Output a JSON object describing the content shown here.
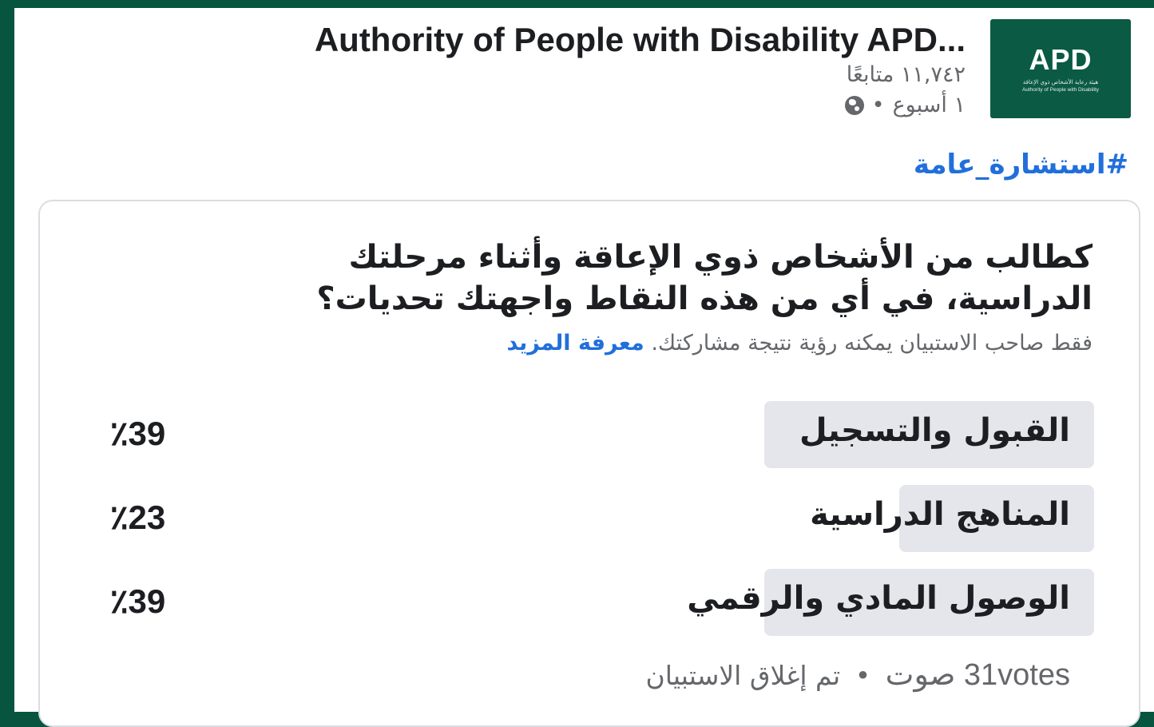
{
  "post": {
    "page_name": "Authority of People with Disability APD...",
    "followers": "١١,٧٤٢ متابعًا",
    "time": "١ أسبوع",
    "dot": "•",
    "hashtag": "#استشارة_عامة",
    "logo": {
      "mark": "APD",
      "subtitle_ar": "هيئة رعاية الأشخاص ذوي الإعاقة",
      "subtitle_en": "Authority of People with Disability",
      "color": "#0b5a44"
    },
    "globe_icon": "globe-icon"
  },
  "poll": {
    "question_line1": "كطالب من الأشخاص ذوي الإعاقة وأثناء مرحلتك",
    "question_line2": "الدراسية، في أي من هذه النقاط واجهتك تحديات؟",
    "notice": "فقط صاحب الاستبيان يمكنه رؤية نتيجة مشاركتك.",
    "learn_more": "معرفة المزيد",
    "options": [
      {
        "label": "القبول والتسجيل",
        "percent": "٪39",
        "fill_fraction": 0.39
      },
      {
        "label": "المناهج الدراسية",
        "percent": "٪23",
        "fill_fraction": 0.23
      },
      {
        "label": "الوصول المادي والرقمي",
        "percent": "٪39",
        "fill_fraction": 0.39
      }
    ],
    "votes": "31votes صوت",
    "separator": "•",
    "status": "تم إغلاق الاستبيان"
  },
  "colors": {
    "background": "#07543f",
    "link": "#216fdb",
    "bar": "#e4e6eb"
  }
}
